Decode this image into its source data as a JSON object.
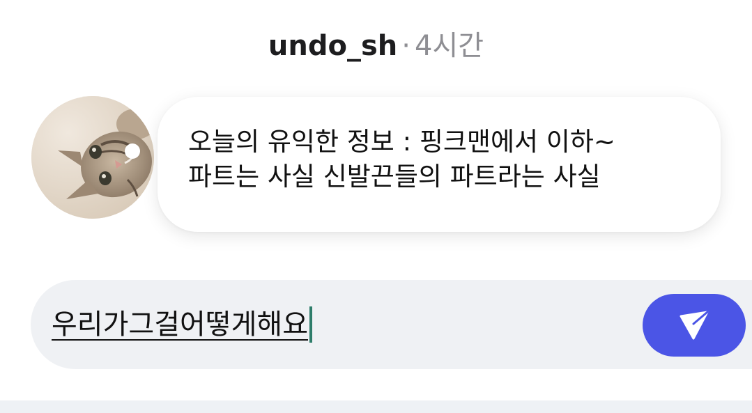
{
  "header": {
    "username": "undo_sh",
    "separator": "·",
    "time_ago": "4시간"
  },
  "post": {
    "avatar_icon": "cat-photo-avatar",
    "text": "오늘의 유익한 정보 : 핑크맨에서 이하~\n파트는 사실 신발끈들의 파트라는 사실"
  },
  "composer": {
    "value": "우리가그걸어떻게해요",
    "send_icon": "paper-plane-icon",
    "send_color": "#4b55e6"
  }
}
